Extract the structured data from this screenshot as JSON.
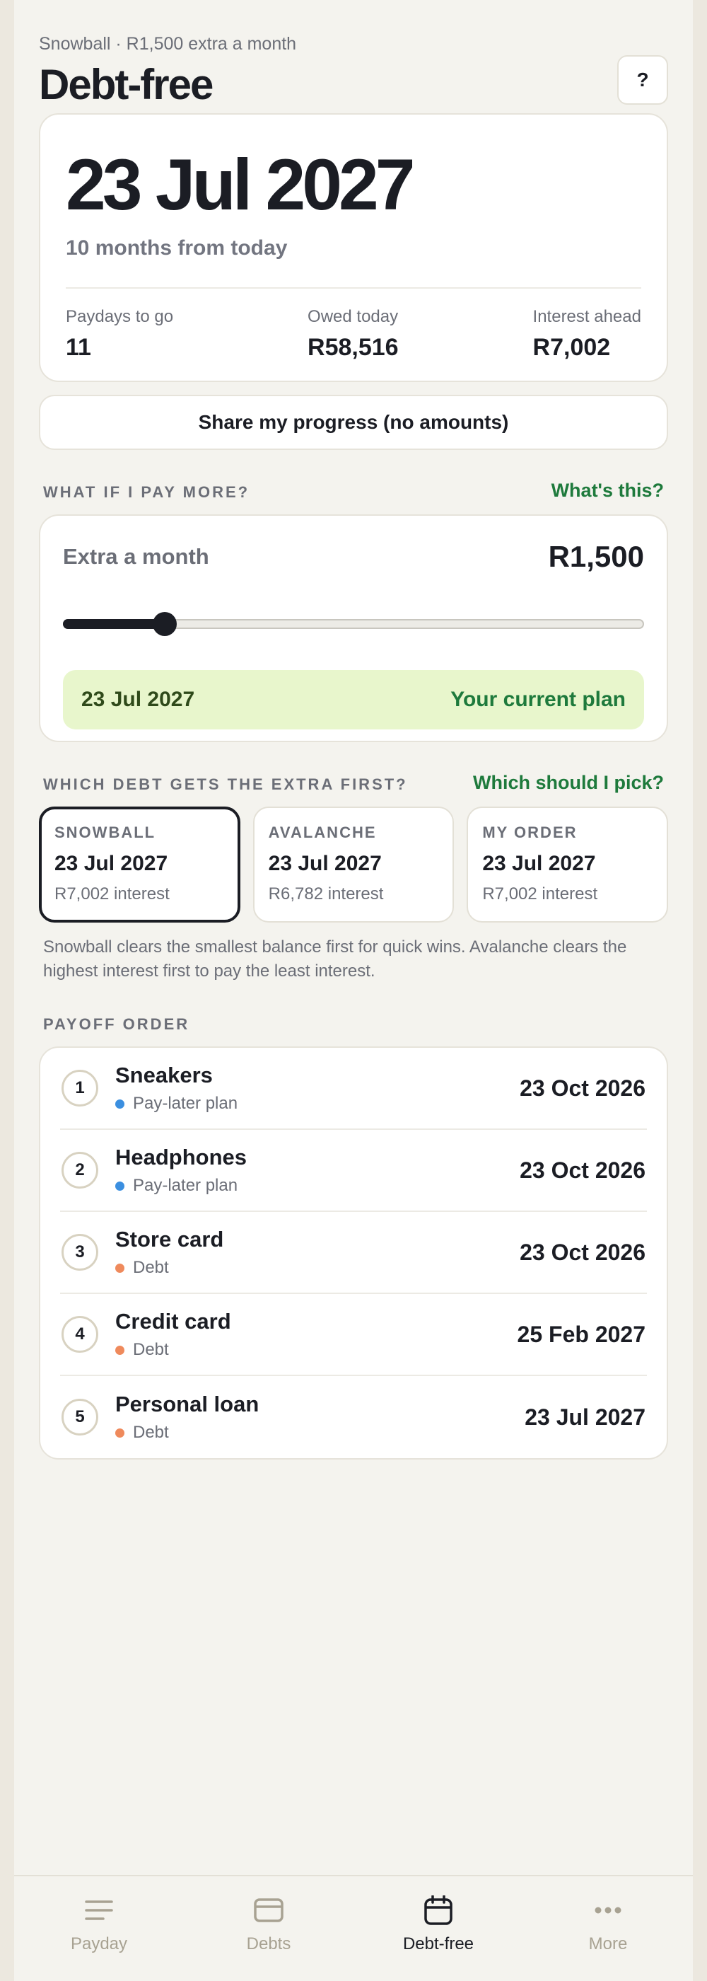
{
  "header": {
    "subtitle": "Snowball · R1,500 extra a month",
    "title": "Debt-free",
    "help_label": "?"
  },
  "hero": {
    "date": "23 Jul 2027",
    "relative": "10 months from today",
    "stats": [
      {
        "label": "Paydays to go",
        "value": "11"
      },
      {
        "label": "Owed today",
        "value": "R58,516"
      },
      {
        "label": "Interest ahead",
        "value": "R7,002"
      }
    ]
  },
  "share": {
    "label": "Share my progress (no amounts)"
  },
  "what_if": {
    "section_title": "WHAT IF I PAY MORE?",
    "link": "What's this?",
    "label": "Extra a month",
    "amount": "R1,500",
    "slider_fraction": 0.175,
    "result_date": "23 Jul 2027",
    "result_tag": "Your current plan"
  },
  "strategy": {
    "section_title": "WHICH DEBT GETS THE EXTRA FIRST?",
    "link": "Which should I pick?",
    "options": [
      {
        "name": "SNOWBALL",
        "date": "23 Jul 2027",
        "interest": "R7,002 interest",
        "selected": true
      },
      {
        "name": "AVALANCHE",
        "date": "23 Jul 2027",
        "interest": "R6,782 interest",
        "selected": false
      },
      {
        "name": "MY ORDER",
        "date": "23 Jul 2027",
        "interest": "R7,002 interest",
        "selected": false
      }
    ],
    "explanation": "Snowball clears the smallest balance first for quick wins. Avalanche clears the highest interest first to pay the least interest."
  },
  "payoff": {
    "section_title": "PAYOFF ORDER",
    "items": [
      {
        "num": "1",
        "name": "Sneakers",
        "kind": "Pay-later plan",
        "kind_color": "#3b8fe0",
        "date": "23 Oct 2026"
      },
      {
        "num": "2",
        "name": "Headphones",
        "kind": "Pay-later plan",
        "kind_color": "#3b8fe0",
        "date": "23 Oct 2026"
      },
      {
        "num": "3",
        "name": "Store card",
        "kind": "Debt",
        "kind_color": "#ef8a5c",
        "date": "23 Oct 2026"
      },
      {
        "num": "4",
        "name": "Credit card",
        "kind": "Debt",
        "kind_color": "#ef8a5c",
        "date": "25 Feb 2027"
      },
      {
        "num": "5",
        "name": "Personal loan",
        "kind": "Debt",
        "kind_color": "#ef8a5c",
        "date": "23 Jul 2027"
      }
    ]
  },
  "nav": {
    "items": [
      {
        "label": "Payday",
        "icon": "lines-icon",
        "active": false
      },
      {
        "label": "Debts",
        "icon": "card-icon",
        "active": false
      },
      {
        "label": "Debt-free",
        "icon": "calendar-icon",
        "active": true
      },
      {
        "label": "More",
        "icon": "dots-icon",
        "active": false
      }
    ]
  }
}
